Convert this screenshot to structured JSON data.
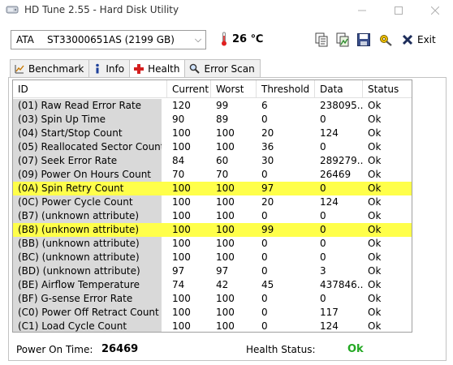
{
  "window": {
    "title": "HD Tune 2.55 - Hard Disk Utility"
  },
  "toolbar": {
    "drive_interface": "ATA",
    "drive_model": "ST33000651AS (2199 GB)",
    "temperature": "26 ℃",
    "exit_label": "Exit"
  },
  "tabs": [
    {
      "label": "Benchmark",
      "icon": "chart-icon"
    },
    {
      "label": "Info",
      "icon": "info-icon"
    },
    {
      "label": "Health",
      "icon": "health-cross-icon",
      "active": true
    },
    {
      "label": "Error Scan",
      "icon": "magnifier-icon"
    }
  ],
  "table": {
    "columns": [
      "ID",
      "Current",
      "Worst",
      "Threshold",
      "Data",
      "Status"
    ],
    "rows": [
      {
        "id": "(01) Raw Read Error Rate",
        "current": "120",
        "worst": "99",
        "threshold": "6",
        "data": "238095...",
        "status": "Ok",
        "highlight": false
      },
      {
        "id": "(03) Spin Up Time",
        "current": "90",
        "worst": "89",
        "threshold": "0",
        "data": "0",
        "status": "Ok",
        "highlight": false
      },
      {
        "id": "(04) Start/Stop Count",
        "current": "100",
        "worst": "100",
        "threshold": "20",
        "data": "124",
        "status": "Ok",
        "highlight": false
      },
      {
        "id": "(05) Reallocated Sector Count",
        "current": "100",
        "worst": "100",
        "threshold": "36",
        "data": "0",
        "status": "Ok",
        "highlight": false
      },
      {
        "id": "(07) Seek Error Rate",
        "current": "84",
        "worst": "60",
        "threshold": "30",
        "data": "289279...",
        "status": "Ok",
        "highlight": false
      },
      {
        "id": "(09) Power On Hours Count",
        "current": "70",
        "worst": "70",
        "threshold": "0",
        "data": "26469",
        "status": "Ok",
        "highlight": false
      },
      {
        "id": "(0A) Spin Retry Count",
        "current": "100",
        "worst": "100",
        "threshold": "97",
        "data": "0",
        "status": "Ok",
        "highlight": true
      },
      {
        "id": "(0C) Power Cycle Count",
        "current": "100",
        "worst": "100",
        "threshold": "20",
        "data": "124",
        "status": "Ok",
        "highlight": false
      },
      {
        "id": "(B7) (unknown attribute)",
        "current": "100",
        "worst": "100",
        "threshold": "0",
        "data": "0",
        "status": "Ok",
        "highlight": false
      },
      {
        "id": "(B8) (unknown attribute)",
        "current": "100",
        "worst": "100",
        "threshold": "99",
        "data": "0",
        "status": "Ok",
        "highlight": true
      },
      {
        "id": "(BB) (unknown attribute)",
        "current": "100",
        "worst": "100",
        "threshold": "0",
        "data": "0",
        "status": "Ok",
        "highlight": false
      },
      {
        "id": "(BC) (unknown attribute)",
        "current": "100",
        "worst": "100",
        "threshold": "0",
        "data": "0",
        "status": "Ok",
        "highlight": false
      },
      {
        "id": "(BD) (unknown attribute)",
        "current": "97",
        "worst": "97",
        "threshold": "0",
        "data": "3",
        "status": "Ok",
        "highlight": false
      },
      {
        "id": "(BE) Airflow Temperature",
        "current": "74",
        "worst": "42",
        "threshold": "45",
        "data": "437846...",
        "status": "Ok",
        "highlight": false
      },
      {
        "id": "(BF) G-sense Error Rate",
        "current": "100",
        "worst": "100",
        "threshold": "0",
        "data": "0",
        "status": "Ok",
        "highlight": false
      },
      {
        "id": "(C0) Power Off Retract Count",
        "current": "100",
        "worst": "100",
        "threshold": "0",
        "data": "117",
        "status": "Ok",
        "highlight": false
      },
      {
        "id": "(C1) Load Cycle Count",
        "current": "100",
        "worst": "100",
        "threshold": "0",
        "data": "124",
        "status": "Ok",
        "highlight": false
      }
    ]
  },
  "footer": {
    "power_on_label": "Power On Time:",
    "power_on_value": "26469",
    "health_label": "Health Status:",
    "health_value": "Ok"
  },
  "colors": {
    "highlight_row": "#ffff4a",
    "health_ok": "#22a822",
    "id_cell_bg": "#d9d9d9"
  }
}
